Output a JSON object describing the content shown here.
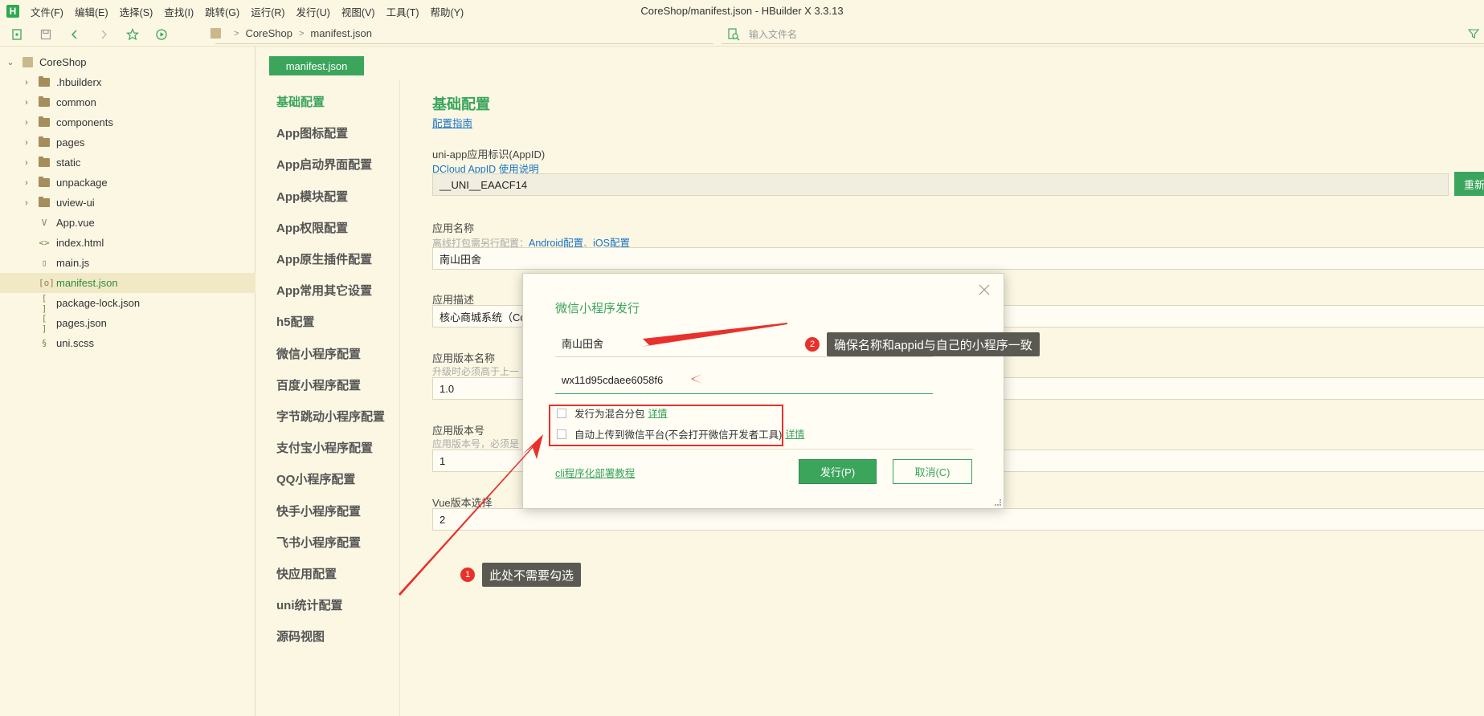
{
  "menubar": {
    "items": [
      "文件(F)",
      "编辑(E)",
      "选择(S)",
      "查找(I)",
      "跳转(G)",
      "运行(R)",
      "发行(U)",
      "视图(V)",
      "工具(T)",
      "帮助(Y)"
    ],
    "title": "CoreShop/manifest.json - HBuilder X 3.3.13"
  },
  "toolbar": {
    "breadcrumb": [
      "CoreShop",
      "manifest.json"
    ],
    "search_placeholder": "输入文件名"
  },
  "tree": {
    "root": "CoreShop",
    "items": [
      {
        "label": ".hbuilderx",
        "kind": "folder"
      },
      {
        "label": "common",
        "kind": "folder"
      },
      {
        "label": "components",
        "kind": "folder"
      },
      {
        "label": "pages",
        "kind": "folder"
      },
      {
        "label": "static",
        "kind": "folder"
      },
      {
        "label": "unpackage",
        "kind": "folder"
      },
      {
        "label": "uview-ui",
        "kind": "folder"
      },
      {
        "label": "App.vue",
        "kind": "file",
        "glyph": "V"
      },
      {
        "label": "index.html",
        "kind": "file",
        "glyph": "<>"
      },
      {
        "label": "main.js",
        "kind": "file",
        "glyph": "▯"
      },
      {
        "label": "manifest.json",
        "kind": "file",
        "glyph": "[o]",
        "selected": true
      },
      {
        "label": "package-lock.json",
        "kind": "file",
        "glyph": "[ ]"
      },
      {
        "label": "pages.json",
        "kind": "file",
        "glyph": "[ ]"
      },
      {
        "label": "uni.scss",
        "kind": "file",
        "glyph": "§"
      }
    ]
  },
  "editor_tab": "manifest.json",
  "nav": {
    "items": [
      "基础配置",
      "App图标配置",
      "App启动界面配置",
      "App模块配置",
      "App权限配置",
      "App原生插件配置",
      "App常用其它设置",
      "h5配置",
      "微信小程序配置",
      "百度小程序配置",
      "字节跳动小程序配置",
      "支付宝小程序配置",
      "QQ小程序配置",
      "快手小程序配置",
      "飞书小程序配置",
      "快应用配置",
      "uni统计配置",
      "源码视图"
    ],
    "active_index": 0
  },
  "form": {
    "title": "基础配置",
    "guide_link": "配置指南",
    "appid_label": "uni-app应用标识(AppID)",
    "appid_link": "DCloud AppID 使用说明",
    "appid_value": "__UNI__EAACF14",
    "regen_button": "重新获",
    "name_label": "应用名称",
    "name_hint_prefix": "离线打包需另行配置：",
    "name_hint_android": "Android配置",
    "name_hint_sep": "、",
    "name_hint_ios": "iOS配置",
    "name_value": "南山田舍",
    "desc_label": "应用描述",
    "desc_value": "核心商城系统（Co",
    "version_name_label": "应用版本名称",
    "version_name_hint": "升级时必须高于上一",
    "version_name_value": "1.0",
    "version_code_label": "应用版本号",
    "version_code_hint": "应用版本号，必须是",
    "version_code_value": "1",
    "vue_label": "Vue版本选择",
    "vue_value": "2"
  },
  "dialog": {
    "title": "微信小程序发行",
    "name_value": "南山田舍",
    "appid_value": "wx11d95cdaee6058f6",
    "check1_label": "发行为混合分包",
    "check1_link": "详情",
    "check2_label": "自动上传到微信平台(不会打开微信开发者工具)",
    "check2_link": "详情",
    "cli_link": "cli程序化部署教程",
    "publish_button": "发行(P)",
    "cancel_button": "取消(C)"
  },
  "annotations": {
    "callout1_num": "1",
    "callout1_text": "此处不需要勾选",
    "callout2_num": "2",
    "callout2_text": "确保名称和appid与自己的小程序一致",
    "color": "#e8312b"
  },
  "colors": {
    "accent": "#3ba55c",
    "background": "#fbf7e3",
    "annotation": "#e8312b"
  }
}
